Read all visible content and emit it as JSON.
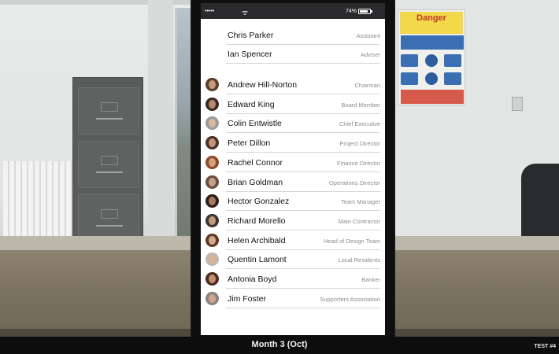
{
  "statusbar": {
    "signal": "•••••",
    "wifi": "ᯤ",
    "battery": "74%"
  },
  "top_contacts": [
    {
      "name": "Chris Parker",
      "role": "Assistant"
    },
    {
      "name": "Ian Spencer",
      "role": "Adviser"
    }
  ],
  "contacts": [
    {
      "name": "Andrew Hill-Norton",
      "role": "Chairman",
      "skin": "#c99a7c",
      "hair": "#5a3e2e"
    },
    {
      "name": "Edward King",
      "role": "Board Member",
      "skin": "#b88a6b",
      "hair": "#3a2a22"
    },
    {
      "name": "Colin Entwistle",
      "role": "Chief Executive",
      "skin": "#d8b8a0",
      "hair": "#9c9a98"
    },
    {
      "name": "Peter Dillon",
      "role": "Project Director",
      "skin": "#c79276",
      "hair": "#4a3428"
    },
    {
      "name": "Rachel Connor",
      "role": "Finance Director",
      "skin": "#d6a080",
      "hair": "#8e4a2a"
    },
    {
      "name": "Brian Goldman",
      "role": "Operations Director",
      "skin": "#c9a085",
      "hair": "#6a5042"
    },
    {
      "name": "Hector Gonzalez",
      "role": "Team Manager",
      "skin": "#a77a5c",
      "hair": "#2a1e18"
    },
    {
      "name": "Richard Morello",
      "role": "Main Contractor",
      "skin": "#c59b80",
      "hair": "#3e3632"
    },
    {
      "name": "Helen Archibald",
      "role": "Head of Design Team",
      "skin": "#d4a98c",
      "hair": "#5c3a28"
    },
    {
      "name": "Quentin Lamont",
      "role": "Local Residents",
      "skin": "#d8b29a",
      "hair": "#bfb7ae"
    },
    {
      "name": "Antonia Boyd",
      "role": "Banker",
      "skin": "#c58f70",
      "hair": "#4a2c20"
    },
    {
      "name": "Jim Foster",
      "role": "Supporters Association",
      "skin": "#cfa68c",
      "hair": "#8a8480"
    }
  ],
  "sign": {
    "title": "Danger"
  },
  "footer": {
    "month": "Month 3 (Oct)",
    "test": "TEST #4"
  }
}
